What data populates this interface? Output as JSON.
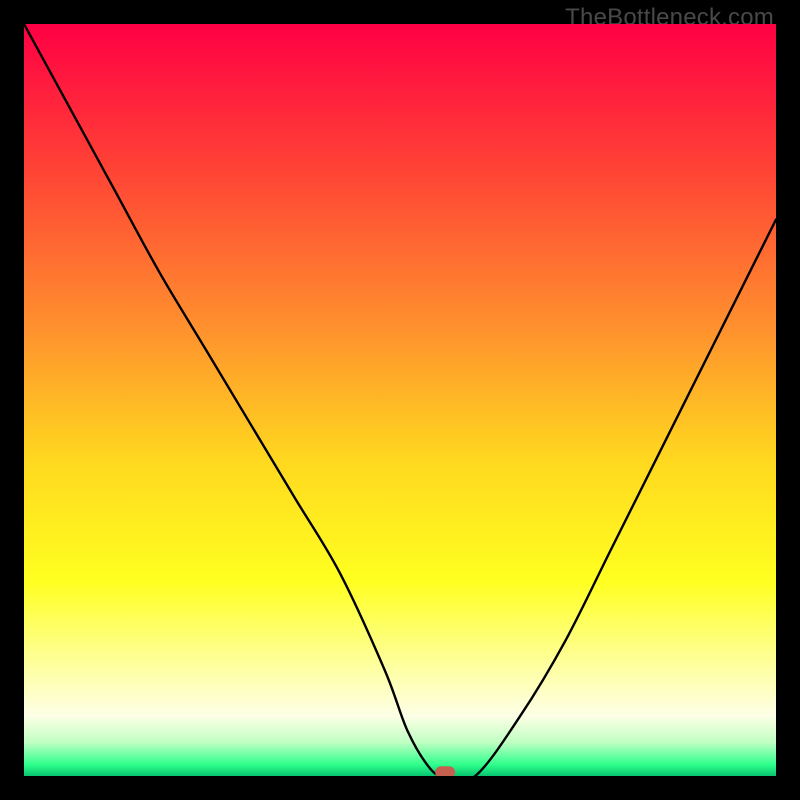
{
  "watermark": "TheBottleneck.com",
  "chart_data": {
    "type": "line",
    "title": "",
    "xlabel": "",
    "ylabel": "",
    "xlim": [
      0,
      100
    ],
    "ylim": [
      0,
      100
    ],
    "grid": false,
    "legend": false,
    "series": [
      {
        "name": "curve",
        "x": [
          0,
          6,
          12,
          18,
          24,
          30,
          36,
          42,
          48,
          51,
          54,
          56,
          60,
          66,
          72,
          78,
          84,
          90,
          96,
          100
        ],
        "y": [
          100,
          89,
          78,
          67,
          57,
          47,
          37,
          27,
          14,
          6,
          1,
          0,
          0,
          8,
          18,
          30,
          42,
          54,
          66,
          74
        ]
      }
    ],
    "marker": {
      "x": 56,
      "y": 0.5,
      "color": "#c56050"
    },
    "background_gradient": {
      "stops": [
        {
          "offset": 0.0,
          "color": "#ff0044"
        },
        {
          "offset": 0.18,
          "color": "#ff3e36"
        },
        {
          "offset": 0.4,
          "color": "#ff8f2e"
        },
        {
          "offset": 0.58,
          "color": "#ffd81f"
        },
        {
          "offset": 0.74,
          "color": "#ffff20"
        },
        {
          "offset": 0.86,
          "color": "#feffa6"
        },
        {
          "offset": 0.92,
          "color": "#fdffe6"
        },
        {
          "offset": 0.955,
          "color": "#c0ffc3"
        },
        {
          "offset": 0.985,
          "color": "#2fff8c"
        },
        {
          "offset": 1.0,
          "color": "#07c46f"
        }
      ]
    }
  }
}
